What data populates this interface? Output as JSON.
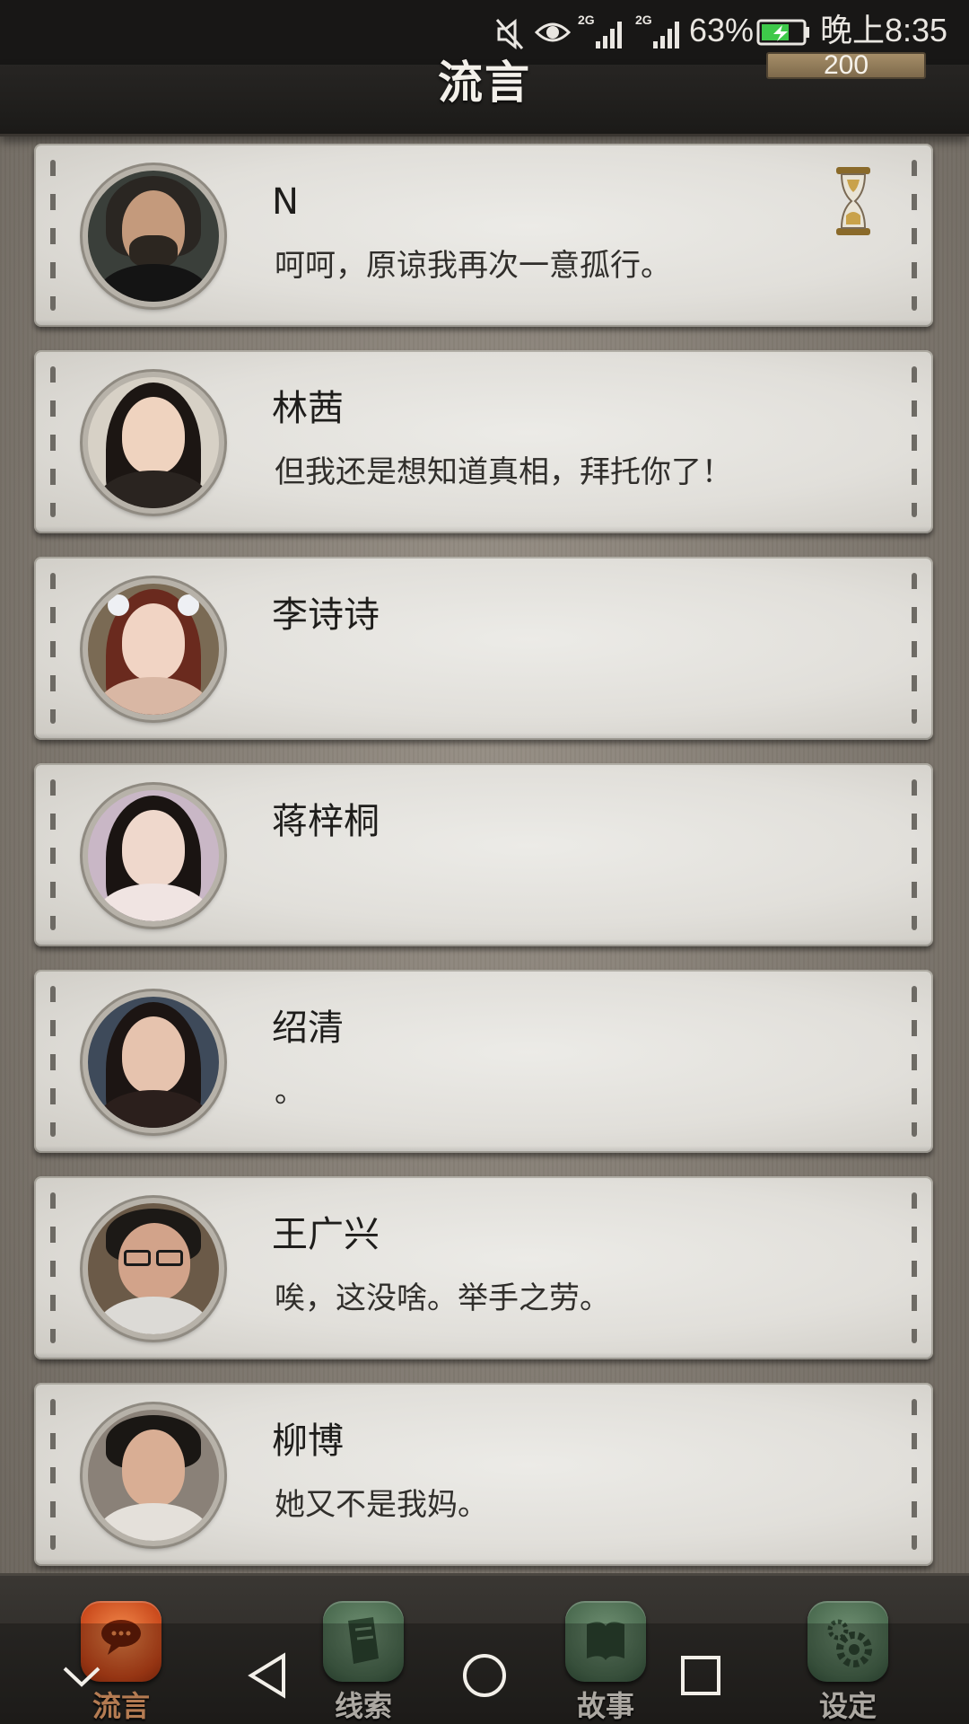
{
  "status_bar": {
    "network_a": "2G",
    "network_b": "2G",
    "battery": "63%",
    "time": "晚上8:35"
  },
  "header": {
    "title": "流言",
    "points": "200"
  },
  "contacts": [
    {
      "name": "N",
      "message": "呵呵，原谅我再次一意孤行。",
      "pending": true
    },
    {
      "name": "林茜",
      "message": "但我还是想知道真相，拜托你了！"
    },
    {
      "name": "李诗诗",
      "message": ""
    },
    {
      "name": "蒋梓桐",
      "message": ""
    },
    {
      "name": "绍清",
      "message": "。"
    },
    {
      "name": "王广兴",
      "message": "唉，这没啥。举手之劳。"
    },
    {
      "name": "柳博",
      "message": "她又不是我妈。"
    }
  ],
  "tabs": [
    {
      "label": "流言",
      "icon": "chat-bubble-icon",
      "active": true
    },
    {
      "label": "线索",
      "icon": "clue-note-icon",
      "active": false
    },
    {
      "label": "故事",
      "icon": "story-book-icon",
      "active": false
    },
    {
      "label": "设定",
      "icon": "gear-settings-icon",
      "active": false
    }
  ],
  "colors": {
    "active_tab": "#d2541f",
    "inactive_tab": "#4a6a4f",
    "card_paper": "#e4e2dd",
    "header_bg": "#1f1d1b"
  }
}
